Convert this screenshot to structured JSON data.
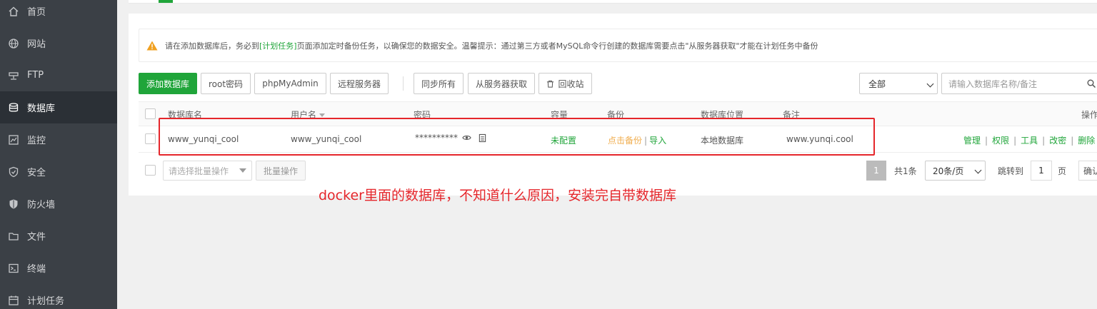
{
  "sidebar": {
    "items": [
      {
        "label": "首页",
        "icon": "home-icon"
      },
      {
        "label": "网站",
        "icon": "globe-icon"
      },
      {
        "label": "FTP",
        "icon": "ftp-icon"
      },
      {
        "label": "数据库",
        "icon": "database-icon",
        "active": true
      },
      {
        "label": "监控",
        "icon": "monitor-icon"
      },
      {
        "label": "安全",
        "icon": "shield-check-icon"
      },
      {
        "label": "防火墙",
        "icon": "firewall-shield-icon"
      },
      {
        "label": "文件",
        "icon": "folder-icon"
      },
      {
        "label": "终端",
        "icon": "terminal-icon"
      },
      {
        "label": "计划任务",
        "icon": "calendar-icon"
      }
    ]
  },
  "notice": {
    "prefix": "请在添加数据库后，务必到",
    "link": "[计划任务]",
    "suffix": "页面添加定时备份任务，以确保您的数据安全。温馨提示：通过第三方或者MySQL命令行创建的数据库需要点击\"从服务器获取\"才能在计划任务中备份"
  },
  "toolbar": {
    "add_db": "添加数据库",
    "root_pwd": "root密码",
    "phpmyadmin": "phpMyAdmin",
    "remote_server": "远程服务器",
    "sync_all": "同步所有",
    "fetch_from_server": "从服务器获取",
    "recycle_bin": "回收站",
    "filter_value": "全部",
    "search_placeholder": "请输入数据库名称/备注"
  },
  "table": {
    "headers": {
      "name": "数据库名",
      "user": "用户名",
      "password": "密码",
      "capacity": "容量",
      "backup": "备份",
      "location": "数据库位置",
      "note": "备注",
      "actions": "操作"
    },
    "rows": [
      {
        "name": "www_yunqi_cool",
        "user": "www_yunqi_cool",
        "password": "**********",
        "capacity": "未配置",
        "backup_link": "点击备份",
        "import_link": "导入",
        "location": "本地数据库",
        "note": "www.yunqi.cool",
        "actions": {
          "manage": "管理",
          "perm": "权限",
          "tools": "工具",
          "change_pwd": "改密",
          "delete": "删除"
        }
      }
    ]
  },
  "footer": {
    "batch_placeholder": "请选择批量操作",
    "batch_btn": "批量操作",
    "current_page": "1",
    "total": "共1条",
    "per_page": "20条/页",
    "goto_label": "跳转到",
    "goto_value": "1",
    "page_unit": "页",
    "confirm": "确认"
  },
  "annotation": "docker里面的数据库，不知道什么原因，安装完自带数据库",
  "colors": {
    "accent": "#20a53a",
    "sidebar_bg": "#3b4046",
    "sidebar_active": "#2b3036",
    "highlight": "#e5262b",
    "backup_link": "#f0ad4e"
  }
}
